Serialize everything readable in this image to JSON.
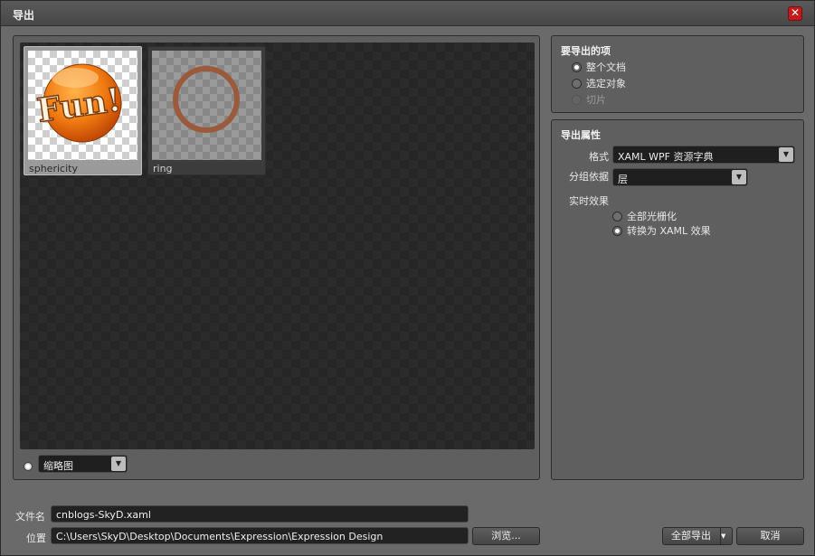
{
  "window": {
    "title": "导出"
  },
  "preview": {
    "items": [
      {
        "label": "sphericity",
        "art_text": "Fun!"
      },
      {
        "label": "ring"
      }
    ],
    "view_mode": "缩略图"
  },
  "export_items": {
    "title": "要导出的项",
    "options": [
      {
        "label": "整个文档",
        "checked": true,
        "enabled": true
      },
      {
        "label": "选定对象",
        "checked": false,
        "enabled": true
      },
      {
        "label": "切片",
        "checked": false,
        "enabled": false
      }
    ]
  },
  "export_props": {
    "title": "导出属性",
    "format_label": "格式",
    "format_value": "XAML WPF 资源字典",
    "group_label": "分组依据",
    "group_value": "层",
    "live_effects_label": "实时效果",
    "effects": [
      {
        "label": "全部光栅化",
        "checked": false
      },
      {
        "label": "转换为 XAML 效果",
        "checked": true
      }
    ]
  },
  "bottom": {
    "filename_label": "文件名",
    "filename_value": "cnblogs-SkyD.xaml",
    "location_label": "位置",
    "location_value": "C:\\Users\\SkyD\\Desktop\\Documents\\Expression\\Expression Design",
    "browse_label": "浏览...",
    "export_all_label": "全部导出",
    "cancel_label": "取消"
  },
  "colors": {
    "accent_close": "#c21b1b",
    "fun_orange": "#f07a10",
    "ring_brown": "#9c5a3c"
  }
}
